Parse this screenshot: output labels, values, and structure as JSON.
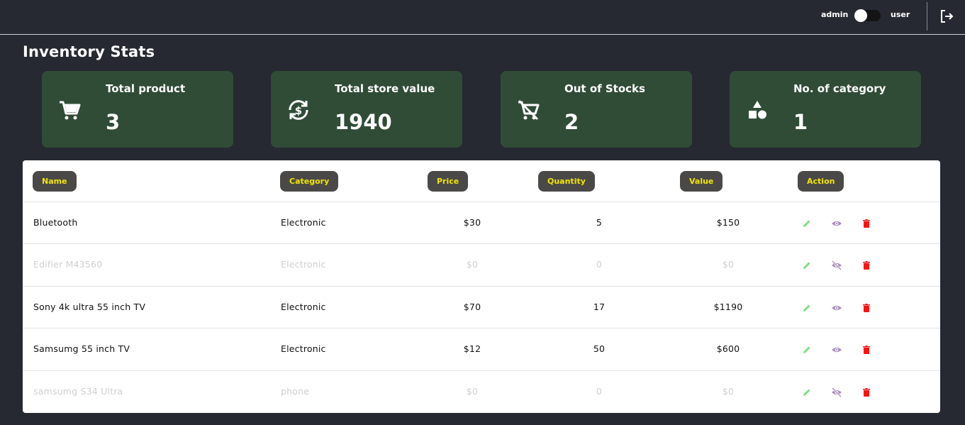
{
  "header": {
    "role_left": "admin",
    "role_right": "user",
    "logout_icon": "logout-icon"
  },
  "page": {
    "title": "Inventory Stats"
  },
  "stats": [
    {
      "label": "Total product",
      "value": "3",
      "icon": "cart-icon"
    },
    {
      "label": "Total store value",
      "value": "1940",
      "icon": "currency-exchange-icon"
    },
    {
      "label": "Out of Stocks",
      "value": "2",
      "icon": "remove-shopping-cart-icon"
    },
    {
      "label": "No. of category",
      "value": "1",
      "icon": "category-shapes-icon"
    }
  ],
  "table": {
    "headers": [
      "Name",
      "Category",
      "Price",
      "Quantity",
      "Value",
      "Action"
    ],
    "rows": [
      {
        "name": "Bluetooth",
        "category": "Electronic",
        "price": "$30",
        "quantity": "5",
        "value": "$150",
        "visible": true
      },
      {
        "name": "Edifier M43560",
        "category": "Electronic",
        "price": "$0",
        "quantity": "0",
        "value": "$0",
        "visible": false
      },
      {
        "name": "Sony 4k ultra 55 inch TV",
        "category": "Electronic",
        "price": "$70",
        "quantity": "17",
        "value": "$1190",
        "visible": true
      },
      {
        "name": "Samsumg 55 inch TV",
        "category": "Electronic",
        "price": "$12",
        "quantity": "50",
        "value": "$600",
        "visible": true
      },
      {
        "name": "samsumg S34 Ultra",
        "category": "phone",
        "price": "$0",
        "quantity": "0",
        "value": "$0",
        "visible": false
      }
    ]
  },
  "colors": {
    "background": "#262931",
    "card": "#304c37",
    "header_pill": "#4a4948",
    "header_text": "#f2e600",
    "edit": "#7ddc7d",
    "view": "#a98fbf",
    "delete": "#ff1111"
  }
}
